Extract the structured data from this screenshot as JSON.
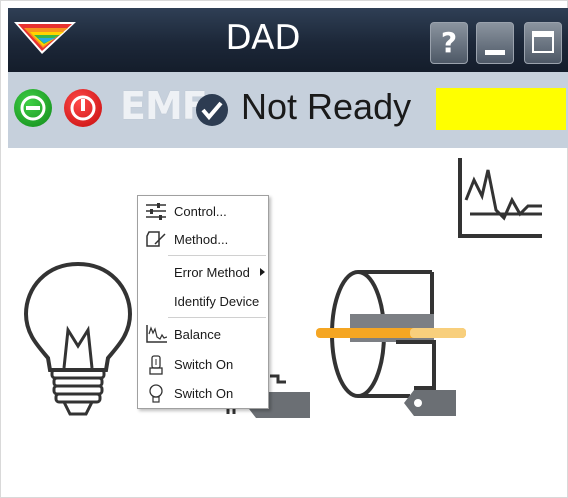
{
  "window": {
    "title": "DAD",
    "help_label": "?"
  },
  "status": {
    "emf_label": "EMF",
    "state_text": "Not Ready",
    "state_color": "#ffff00"
  },
  "icons": {
    "logo": "rainbow-logo-icon",
    "green_button": "minus-circle-icon",
    "red_button": "power-icon",
    "check": "check-circle-icon",
    "baseline_chart": "signal-chart-icon",
    "lamp": "lightbulb-icon",
    "flow_cell": "flow-cell-icon"
  },
  "context_menu": {
    "items": [
      {
        "label": "Control...",
        "icon": "sliders-icon"
      },
      {
        "label": "Method...",
        "icon": "method-icon"
      },
      {
        "label": "Error Method",
        "icon": "",
        "has_submenu": true
      },
      {
        "label": "Identify Device",
        "icon": ""
      },
      {
        "label": "Balance",
        "icon": "balance-icon"
      },
      {
        "label": "Switch On",
        "icon": "lamp-tube-icon"
      },
      {
        "label": "Switch On",
        "icon": "bulb-small-icon"
      }
    ]
  },
  "colors": {
    "titlebar": "#1c2738",
    "statusbar": "#c6d0dc",
    "highlight_beam": "#f5a623"
  }
}
